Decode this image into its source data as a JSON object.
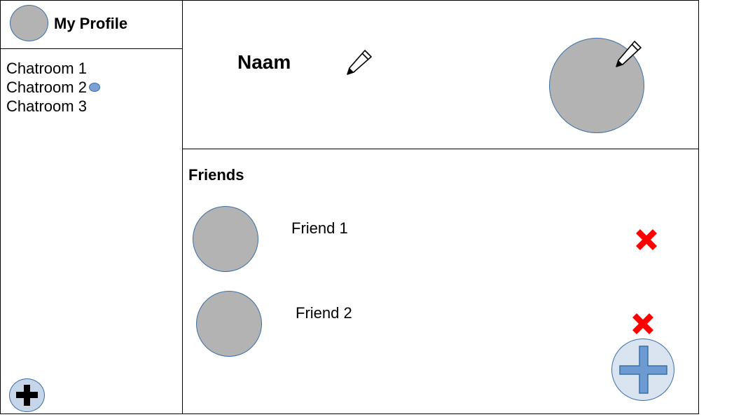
{
  "sidebar": {
    "title": "My Profile",
    "chatrooms": [
      {
        "label": "Chatroom 1",
        "unread": false
      },
      {
        "label": "Chatroom 2",
        "unread": true
      },
      {
        "label": "Chatroom 3",
        "unread": false
      }
    ],
    "add_button_icon": "plus-icon"
  },
  "profile": {
    "name": "Naam",
    "edit_name_icon": "pencil-icon",
    "edit_picture_icon": "pencil-icon"
  },
  "friends": {
    "title": "Friends",
    "items": [
      {
        "name": "Friend 1",
        "remove_icon": "red-x-icon"
      },
      {
        "name": "Friend 2",
        "remove_icon": "red-x-icon"
      }
    ],
    "add_button_icon": "plus-icon"
  },
  "colors": {
    "avatar_fill": "#b3b3b3",
    "avatar_border": "#3a6ea5",
    "remove_red": "#ff0000",
    "add_button_blue": "#6d9bd1"
  }
}
